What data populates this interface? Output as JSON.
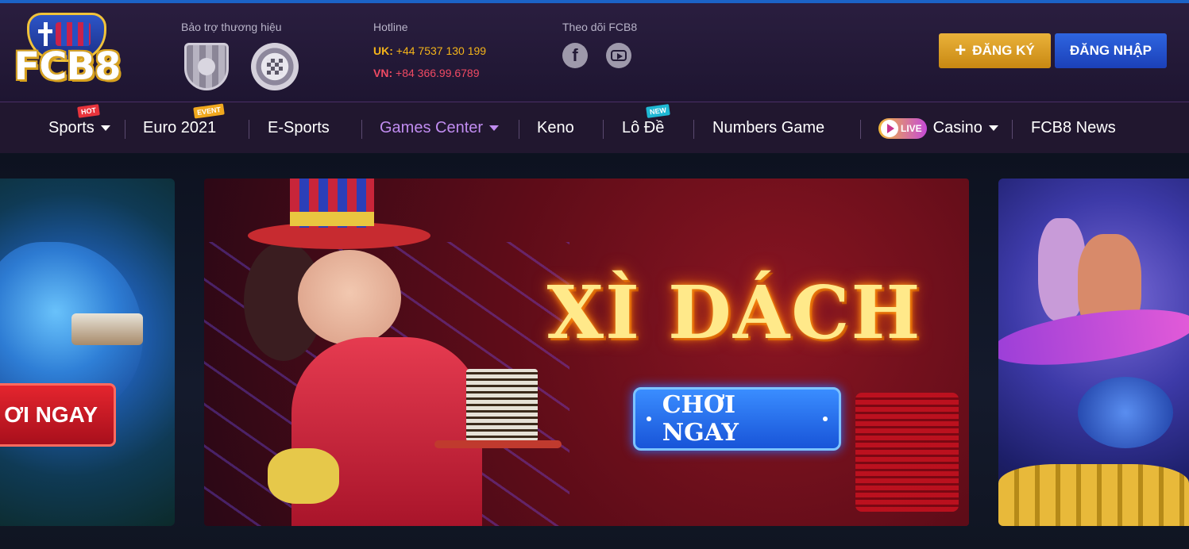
{
  "header": {
    "logo_text": "FCB8",
    "sponsor_label": "Bảo trợ thương hiệu",
    "hotline": {
      "label": "Hotline",
      "uk_prefix": "UK:",
      "uk_number": "+44 7537 130 199",
      "vn_prefix": "VN:",
      "vn_number": "+84 366.99.6789"
    },
    "follow_label": "Theo dõi FCB8",
    "register_label": "ĐĂNG KÝ",
    "login_label": "ĐĂNG NHẬP"
  },
  "nav": {
    "sports": "Sports",
    "sports_badge": "HOT",
    "euro": "Euro 2021",
    "euro_badge": "EVENT",
    "esports": "E-Sports",
    "games_center": "Games Center",
    "keno": "Keno",
    "lode": "Lô Đề",
    "lode_badge": "NEW",
    "numbers": "Numbers Game",
    "live_badge": "LIVE",
    "casino": "Casino",
    "news": "FCB8 News"
  },
  "hero": {
    "left_play_label": "ƠI NGAY",
    "main_title": "XÌ DÁCH",
    "main_play_label": "CHƠI NGAY"
  },
  "colors": {
    "accent_blue": "#1b63c6",
    "register_gold": "#e0a52a",
    "login_blue": "#2453d4",
    "nav_active": "#c08cf0"
  },
  "icons": [
    "facebook-icon",
    "youtube-icon",
    "caret-down-icon",
    "live-play-icon",
    "plus-icon"
  ]
}
